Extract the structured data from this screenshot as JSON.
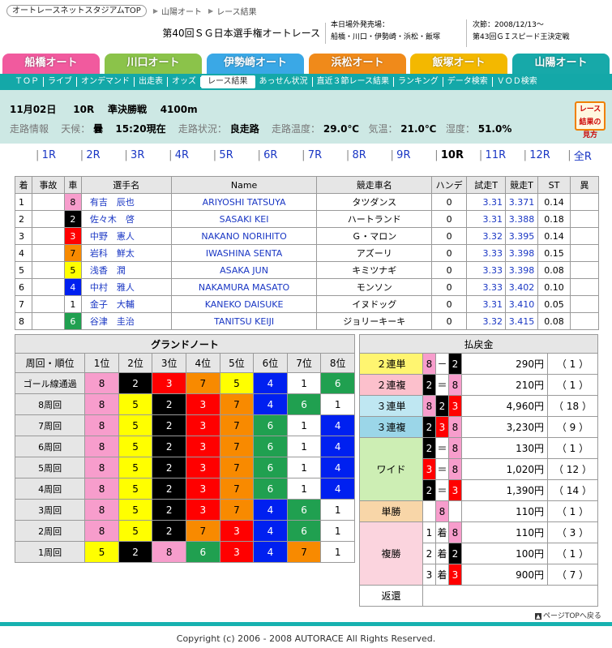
{
  "breadcrumb": {
    "top": "オートレースネットスタジアムTOP",
    "venue": "山陽オート",
    "page": "レース結果"
  },
  "header": {
    "title": "第40回ＳＧ日本選手権オートレース",
    "off_label": "本日場外発売場：",
    "off_sites": "船橋・川口・伊勢崎・浜松・飯塚",
    "next_label": "次節：2008/12/13～",
    "next_title": "第43回ＧＩスピード王決定戦"
  },
  "tabs": [
    {
      "label": "船橋オート",
      "color": "#f15a9e"
    },
    {
      "label": "川口オート",
      "color": "#8bc34a"
    },
    {
      "label": "伊勢崎オート",
      "color": "#3aa8e6"
    },
    {
      "label": "浜松オート",
      "color": "#f08a1a"
    },
    {
      "label": "飯塚オート",
      "color": "#f3b800"
    },
    {
      "label": "山陽オート",
      "color": "#17a9a9"
    }
  ],
  "subnav": [
    "ＴＯＰ",
    "ライブ",
    "オンデマンド",
    "出走表",
    "オッズ",
    "レース結果",
    "あっせん状況",
    "直近３節レース結果",
    "ランキング",
    "データ検索",
    "ＶＯＤ検索"
  ],
  "race": {
    "date": "11月02日",
    "rno": "10R",
    "kind": "準決勝戦",
    "dist": "4100m",
    "info_label": "走路情報",
    "weather_label": "天候：",
    "weather": "曇",
    "time": "15:20現在",
    "track_label": "走路状況：",
    "track": "良走路",
    "ttemp_label": "走路温度：",
    "ttemp": "29.0℃",
    "temp_label": "気温：",
    "temp": "21.0℃",
    "hum_label": "湿度：",
    "hum": "51.0%",
    "howto": "レース結果の見方"
  },
  "race_nav": [
    "1R",
    "2R",
    "3R",
    "4R",
    "5R",
    "6R",
    "7R",
    "8R",
    "9R",
    "10R",
    "11R",
    "12R",
    "全R"
  ],
  "entry_headers": [
    "着",
    "事故",
    "車",
    "選手名",
    "Name",
    "競走車名",
    "ハンデ",
    "試走T",
    "競走T",
    "ST",
    "異"
  ],
  "entries": [
    {
      "pos": "1",
      "acc": "",
      "car": "8",
      "name": "有吉　辰也",
      "en": "ARIYOSHI TATSUYA",
      "bike": "タツダンス",
      "handi": "0",
      "trial": "3.31",
      "race": "3.371",
      "st": "0.14",
      "ab": ""
    },
    {
      "pos": "2",
      "acc": "",
      "car": "2",
      "name": "佐々木　啓",
      "en": "SASAKI KEI",
      "bike": "ハートランド",
      "handi": "0",
      "trial": "3.31",
      "race": "3.388",
      "st": "0.18",
      "ab": ""
    },
    {
      "pos": "3",
      "acc": "",
      "car": "3",
      "name": "中野　憲人",
      "en": "NAKANO NORIHITO",
      "bike": "Ｇ・マロン",
      "handi": "0",
      "trial": "3.32",
      "race": "3.395",
      "st": "0.14",
      "ab": ""
    },
    {
      "pos": "4",
      "acc": "",
      "car": "7",
      "name": "岩科　鮮太",
      "en": "IWASHINA SENTA",
      "bike": "アズーリ",
      "handi": "0",
      "trial": "3.33",
      "race": "3.398",
      "st": "0.15",
      "ab": ""
    },
    {
      "pos": "5",
      "acc": "",
      "car": "5",
      "name": "浅香　潤",
      "en": "ASAKA JUN",
      "bike": "キミツナギ",
      "handi": "0",
      "trial": "3.33",
      "race": "3.398",
      "st": "0.08",
      "ab": ""
    },
    {
      "pos": "6",
      "acc": "",
      "car": "4",
      "name": "中村　雅人",
      "en": "NAKAMURA MASATO",
      "bike": "モンソン",
      "handi": "0",
      "trial": "3.33",
      "race": "3.402",
      "st": "0.10",
      "ab": ""
    },
    {
      "pos": "7",
      "acc": "",
      "car": "1",
      "name": "金子　大輔",
      "en": "KANEKO DAISUKE",
      "bike": "イヌドッグ",
      "handi": "0",
      "trial": "3.31",
      "race": "3.410",
      "st": "0.05",
      "ab": ""
    },
    {
      "pos": "8",
      "acc": "",
      "car": "6",
      "name": "谷津　圭治",
      "en": "TANITSU KEIJI",
      "bike": "ジョリーキーキ",
      "handi": "0",
      "trial": "3.32",
      "race": "3.415",
      "st": "0.08",
      "ab": ""
    }
  ],
  "grand": {
    "caption": "グランドノート",
    "headers": [
      "周回・順位",
      "1位",
      "2位",
      "3位",
      "4位",
      "5位",
      "6位",
      "7位",
      "8位"
    ],
    "rows": [
      {
        "label": "ゴール線通過",
        "cars": [
          "8",
          "2",
          "3",
          "7",
          "5",
          "4",
          "1",
          "6"
        ]
      },
      {
        "label": "8周回",
        "cars": [
          "8",
          "5",
          "2",
          "3",
          "7",
          "4",
          "6",
          "1"
        ]
      },
      {
        "label": "7周回",
        "cars": [
          "8",
          "5",
          "2",
          "3",
          "7",
          "6",
          "1",
          "4"
        ]
      },
      {
        "label": "6周回",
        "cars": [
          "8",
          "5",
          "2",
          "3",
          "7",
          "6",
          "1",
          "4"
        ]
      },
      {
        "label": "5周回",
        "cars": [
          "8",
          "5",
          "2",
          "3",
          "7",
          "6",
          "1",
          "4"
        ]
      },
      {
        "label": "4周回",
        "cars": [
          "8",
          "5",
          "2",
          "3",
          "7",
          "6",
          "1",
          "4"
        ]
      },
      {
        "label": "3周回",
        "cars": [
          "8",
          "5",
          "2",
          "3",
          "7",
          "4",
          "6",
          "1"
        ]
      },
      {
        "label": "2周回",
        "cars": [
          "8",
          "5",
          "2",
          "7",
          "3",
          "4",
          "6",
          "1"
        ]
      },
      {
        "label": "1周回",
        "cars": [
          "5",
          "2",
          "8",
          "6",
          "3",
          "4",
          "7",
          "1"
        ]
      }
    ]
  },
  "payout": {
    "caption": "払戻金",
    "nirentan": "２連単",
    "nirenfuku": "２連複",
    "sanrentan": "３連単",
    "sanrenfuku": "３連複",
    "wide": "ワイド",
    "tansho": "単勝",
    "fukusho": "複勝",
    "henkan": "返還",
    "dash": "－",
    "eq": "＝",
    "chaku": "着",
    "r2t": {
      "a": "8",
      "b": "2",
      "amt": "290円",
      "pop": "（ 1 ）"
    },
    "r2f": {
      "a": "2",
      "b": "8",
      "amt": "210円",
      "pop": "（ 1 ）"
    },
    "r3t": {
      "a": "8",
      "b": "2",
      "c": "3",
      "amt": "4,960円",
      "pop": "（ 18 ）"
    },
    "r3f": {
      "a": "2",
      "b": "3",
      "c": "8",
      "amt": "3,230円",
      "pop": "（ 9 ）"
    },
    "wd": [
      {
        "a": "2",
        "b": "8",
        "amt": "130円",
        "pop": "（ 1 ）"
      },
      {
        "a": "3",
        "b": "8",
        "amt": "1,020円",
        "pop": "（ 12 ）"
      },
      {
        "a": "2",
        "b": "3",
        "amt": "1,390円",
        "pop": "（ 14 ）"
      }
    ],
    "tn": {
      "a": "8",
      "amt": "110円",
      "pop": "（ 1 ）"
    },
    "fk": [
      {
        "rank": "1",
        "a": "8",
        "amt": "110円",
        "pop": "（ 3 ）"
      },
      {
        "rank": "2",
        "a": "2",
        "amt": "100円",
        "pop": "（ 1 ）"
      },
      {
        "rank": "3",
        "a": "3",
        "amt": "900円",
        "pop": "（ 7 ）"
      }
    ]
  },
  "pagetop": "ページTOPへ戻る",
  "footer": "Copyright (c) 2006 - 2008 AUTORACE All Rights Reserved."
}
